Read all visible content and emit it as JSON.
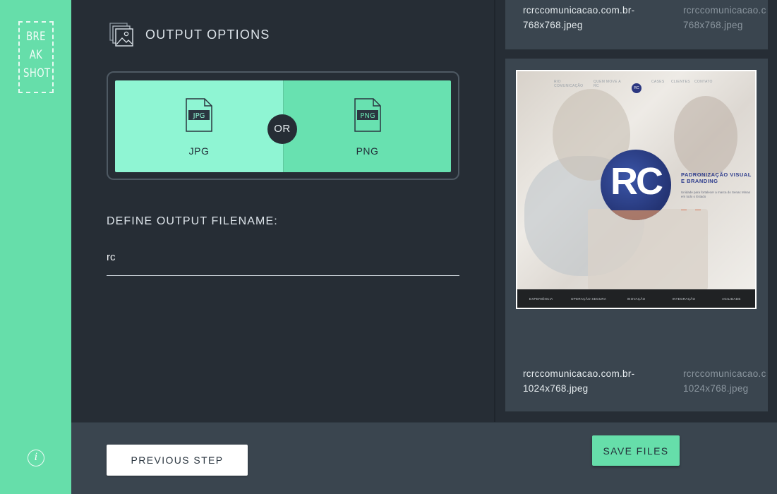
{
  "sidebar": {
    "logo_lines": [
      "BRE",
      "AK",
      "SHOT"
    ],
    "info_icon": "i"
  },
  "main": {
    "section_title": "OUTPUT OPTIONS",
    "formats": [
      {
        "label": "JPG",
        "icon_text": "JPG",
        "selected": true
      },
      {
        "label": "PNG",
        "icon_text": "PNG",
        "selected": false
      }
    ],
    "or_label": "OR",
    "filename_label": "DEFINE OUTPUT FILENAME:",
    "filename_value": "rc"
  },
  "footer": {
    "previous_label": "PREVIOUS STEP",
    "save_label": "SAVE FILES"
  },
  "preview": {
    "files": [
      {
        "name_line1": "rcrccomunicacao.com.br-",
        "name_line2": "768x768.jpeg",
        "ghost_line1": "rcrccomunicacao.c",
        "ghost_line2": "768x768.jpeg"
      },
      {
        "name_line1": "rcrccomunicacao.com.br-",
        "name_line2": "1024x768.jpeg",
        "ghost_line1": "rcrccomunicacao.c",
        "ghost_line2": "1024x768.jpeg"
      }
    ],
    "thumbnail": {
      "nav": [
        "RIO COMUNICAÇÃO",
        "QUEM MOVE A RC",
        "CASES",
        "CLIENTES",
        "CONTATO"
      ],
      "logo": "RC",
      "circle_text": "RC",
      "headline": "PADRONIZAÇÃO VISUAL E BRANDING",
      "subtext": "Unidade para fortalecer a marca do Senac Minas em todo o Estado",
      "footer_items": [
        "EXPERIÊNCIA",
        "OPERAÇÃO SEGURA",
        "INOVAÇÃO",
        "INTEGRAÇÃO",
        "AGILIDADE"
      ]
    }
  },
  "colors": {
    "accent": "#66deaa",
    "jpg_selected": "#8ff5d3",
    "png": "#68e1b0",
    "background": "#262d35",
    "panel": "#3a454f"
  },
  "icons": [
    "gallery-icon",
    "jpg-file-icon",
    "png-file-icon",
    "info-icon"
  ]
}
